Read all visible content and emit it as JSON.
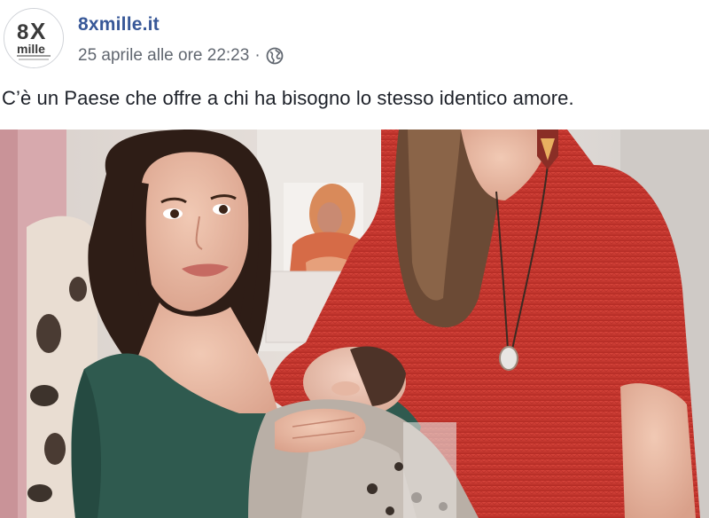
{
  "page": {
    "name": "8xmille.it",
    "timestamp": "25 aprile alle ore 22:23",
    "separator": "·",
    "privacy_icon": "globe-icon"
  },
  "avatar": {
    "logo_text": "8X mille",
    "logo_icon": "8xmille-logo"
  },
  "post": {
    "text": "C’è un Paese che offre a chi ha bisogno lo stesso identico amore."
  },
  "photo": {
    "subject": "photo-breastfeeding-mother-with-woman-in-red-sweater"
  },
  "colors": {
    "link": "#385898",
    "meta": "#616770",
    "text": "#1d2129",
    "sweater": "#c8362d",
    "top_green": "#2f5a4f"
  }
}
